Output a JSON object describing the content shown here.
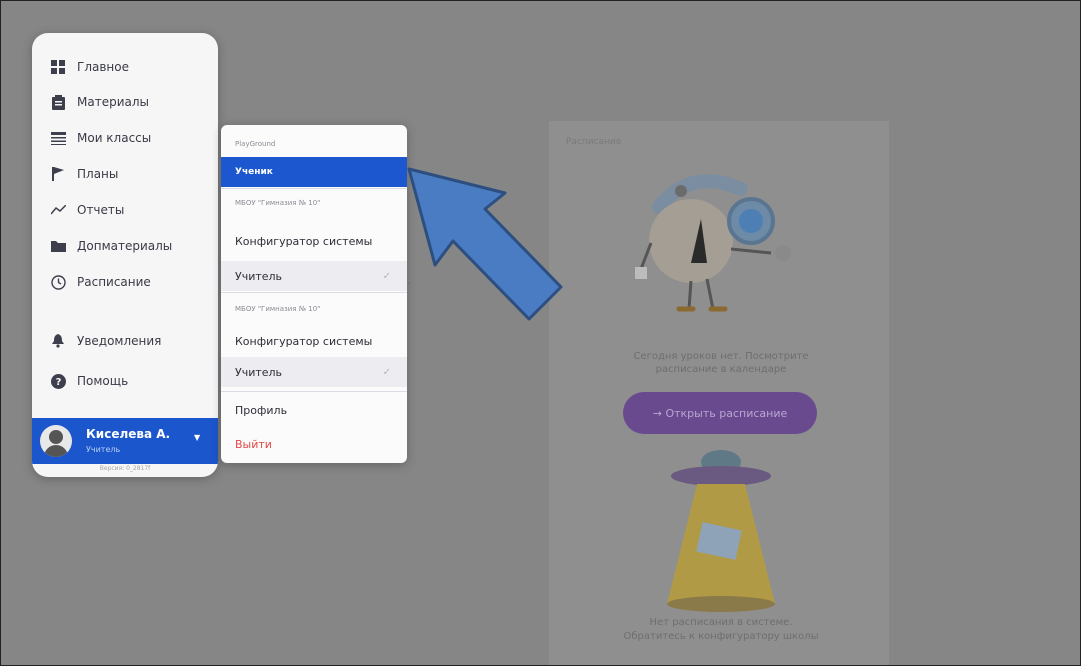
{
  "background": {
    "section_title": "Расписание",
    "no_lessons_text": [
      "Сегодня уроков нет. Посмотрите",
      "расписание в календаре"
    ],
    "open_schedule_button": "→ Открыть расписание",
    "no_schedule_text": [
      "Нет расписания в системе.",
      "Обратитесь к конфигуратору школы"
    ],
    "stray_label": "-"
  },
  "sidebar": {
    "items": [
      {
        "label": "Главное",
        "icon": "dashboard-icon"
      },
      {
        "label": "Материалы",
        "icon": "clipboard-icon"
      },
      {
        "label": "Мои классы",
        "icon": "table-icon"
      },
      {
        "label": "Планы",
        "icon": "flag-icon"
      },
      {
        "label": "Отчеты",
        "icon": "chart-line-icon"
      },
      {
        "label": "Допматериалы",
        "icon": "folder-icon"
      },
      {
        "label": "Расписание",
        "icon": "clock-icon"
      },
      {
        "label": "Уведомления",
        "icon": "bell-icon"
      },
      {
        "label": "Помощь",
        "icon": "help-icon"
      }
    ],
    "user": {
      "name": "Киселева А.",
      "role": "Учитель"
    },
    "version": "Версия: 0_2817f"
  },
  "menu": {
    "group_playground": "PlayGround",
    "student_label": "Ученик",
    "group_school_1": "МБОУ \"Гимназия № 10\"",
    "configurator_1": "Конфигуратор системы",
    "teacher_1": "Учитель",
    "group_school_2": "МБОУ \"Гимназия № 10\"",
    "configurator_2": "Конфигуратор системы",
    "teacher_2": "Учитель",
    "profile": "Профиль",
    "logout": "Выйти",
    "check_glyph": "✓"
  },
  "colors": {
    "accent": "#1c57cf",
    "arrow_fill": "#4a7cc4",
    "arrow_stroke": "#2c4f80",
    "danger": "#e04949"
  }
}
